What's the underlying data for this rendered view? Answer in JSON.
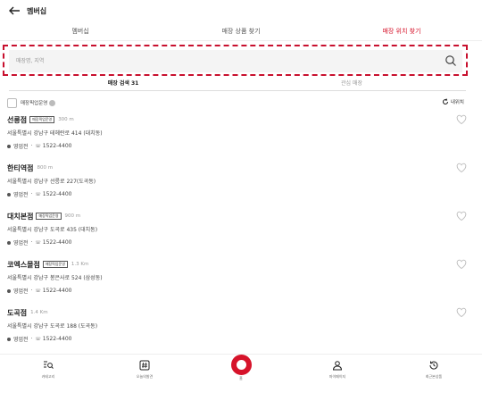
{
  "header": {
    "title": "멤버십"
  },
  "tabs": [
    {
      "label": "멤버십"
    },
    {
      "label": "매장 상품 찾기"
    },
    {
      "label": "매장 위치 찾기"
    }
  ],
  "search": {
    "placeholder": "매장명, 지역"
  },
  "subtabs": [
    {
      "label": "매장 검색 31"
    },
    {
      "label": "관심 매장"
    }
  ],
  "filter": {
    "label": "매장픽업운영"
  },
  "nearby": {
    "label": "내위치"
  },
  "stores": [
    {
      "name": "선릉점",
      "badge": "매장픽업운영",
      "distance": "300 m",
      "address": "서울특별시 강남구 테헤란로 414 (대치동)",
      "status": "영업전",
      "phone": "1522-4400"
    },
    {
      "name": "한티역점",
      "badge": "",
      "distance": "800 m",
      "address": "서울특별시 강남구 선릉로 227(도곡동)",
      "status": "영업전",
      "phone": "1522-4400"
    },
    {
      "name": "대치본점",
      "badge": "매장픽업운영",
      "distance": "900 m",
      "address": "서울특별시 강남구 도곡로 435 (대치동)",
      "status": "영업전",
      "phone": "1522-4400"
    },
    {
      "name": "코엑스몰점",
      "badge": "매장픽업운영",
      "distance": "1.3 Km",
      "address": "서울특별시 강남구 봉은사로 524 (삼성동)",
      "status": "영업전",
      "phone": "1522-4400"
    },
    {
      "name": "도곡점",
      "badge": "",
      "distance": "1.4 Km",
      "address": "서울특별시 강남구 도곡로 188 (도곡동)",
      "status": "영업전",
      "phone": "1522-4400"
    }
  ],
  "bottom_nav": [
    {
      "label": "카테고리",
      "icon": "category-search-icon"
    },
    {
      "label": "오늘의발견",
      "icon": "hashtag-icon"
    },
    {
      "label": "홈",
      "icon": "home-ring-icon"
    },
    {
      "label": "마이페이지",
      "icon": "person-icon"
    },
    {
      "label": "최근본상품",
      "icon": "history-icon"
    }
  ],
  "colors": {
    "accent": "#d6132a"
  }
}
